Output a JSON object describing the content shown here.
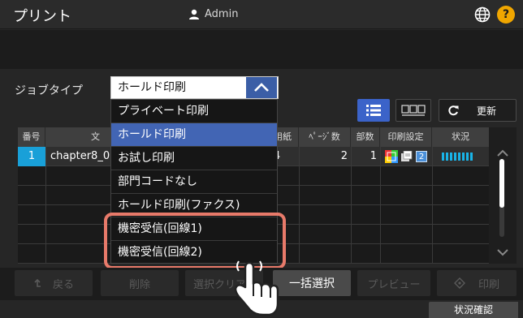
{
  "app": {
    "title": "プリント",
    "user": "Admin"
  },
  "job_type": {
    "label": "ジョブタイプ",
    "selected": "ホールド印刷"
  },
  "dropdown": {
    "options": [
      "プライベート印刷",
      "ホールド印刷",
      "お試し印刷",
      "部門コードなし",
      "ホールド印刷(ファクス)",
      "機密受信(回線1)",
      "機密受信(回線2)"
    ],
    "selected_index": 1
  },
  "toolbar": {
    "refresh_label": "更新"
  },
  "table": {
    "columns": [
      "番号",
      "文",
      "用紙",
      "ﾍﾟｰｼﾞ数",
      "部数",
      "印刷設定",
      "状況"
    ],
    "rows": [
      {
        "num": "1",
        "doc": "chapter8_0",
        "paper": "A4",
        "pages": "2",
        "copies": "1",
        "settings_badge": "2"
      }
    ]
  },
  "bottom": {
    "back": "戻る",
    "delete": "削除",
    "select_clear": "選択クリア",
    "select_all": "一括選択",
    "preview": "プレビュー",
    "print": "印刷",
    "status": "状況確認"
  },
  "colors": {
    "accent_blue": "#4265b4",
    "number_cell": "#19a0d8",
    "highlight": "#e87a6a",
    "help": "#f0a600"
  }
}
